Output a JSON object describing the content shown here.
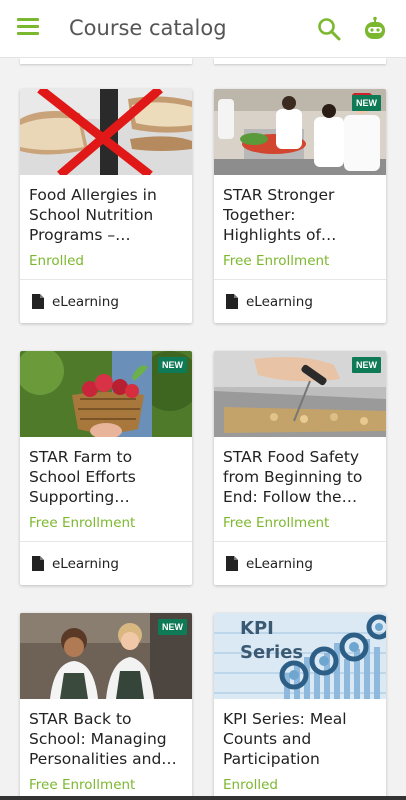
{
  "app": {
    "title": "Course catalog",
    "accent": "#7cb82f",
    "badge_color": "#0f7a56"
  },
  "icons": {
    "menu": "hamburger-menu-icon",
    "search": "search-icon",
    "assistant": "robot-assistant-icon",
    "course_type": "document-icon"
  },
  "courses": [
    {
      "title": "Food Allergies in School Nutrition Programs – Avoiding…",
      "status": "Enrolled",
      "type": "eLearning",
      "badge": ""
    },
    {
      "title": "STAR Stronger Together: Highlights of School…",
      "status": "Free Enrollment",
      "type": "eLearning",
      "badge": "NEW"
    },
    {
      "title": "STAR Farm to School Efforts Supporting Resilience…",
      "status": "Free Enrollment",
      "type": "eLearning",
      "badge": "NEW"
    },
    {
      "title": "STAR Food Safety from Beginning to End:  Follow the Flow…",
      "status": "Free Enrollment",
      "type": "eLearning",
      "badge": "NEW"
    },
    {
      "title": "STAR Back to School: Managing Personalities and…",
      "status": "Free Enrollment",
      "type": "eLearning",
      "badge": "NEW"
    },
    {
      "title": "KPI Series: Meal Counts and Participation",
      "status": "Enrolled",
      "type": "eLearning",
      "badge": "",
      "image_text": "KPI Series"
    }
  ]
}
